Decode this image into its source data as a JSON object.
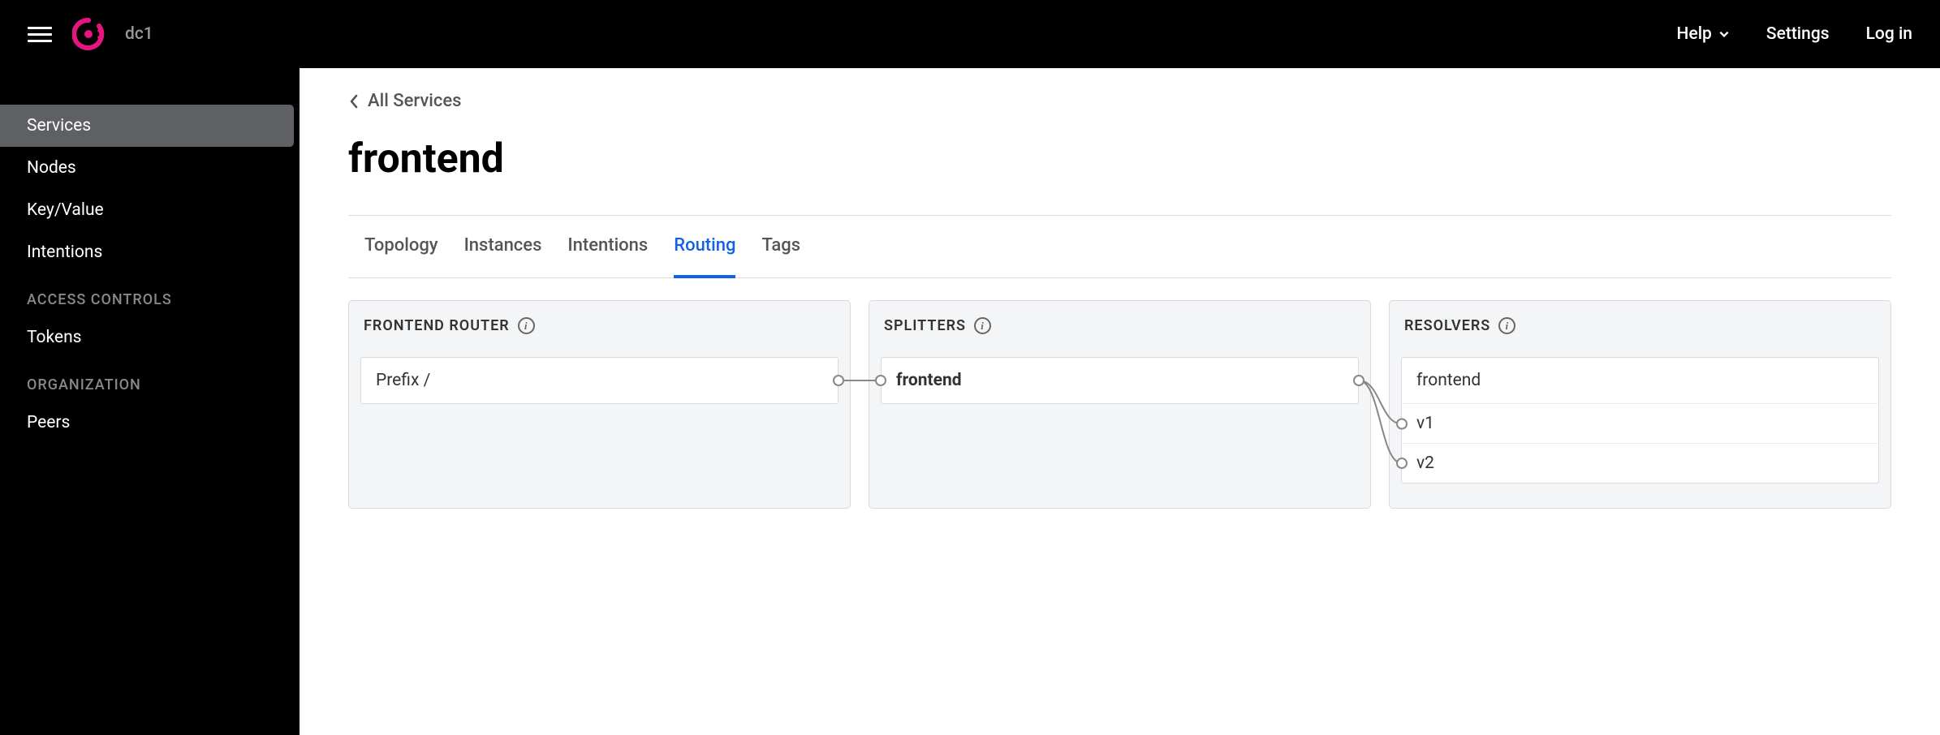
{
  "header": {
    "datacenter": "dc1",
    "help": "Help",
    "settings": "Settings",
    "login": "Log in"
  },
  "sidebar": {
    "items": [
      {
        "label": "Services",
        "active": true
      },
      {
        "label": "Nodes",
        "active": false
      },
      {
        "label": "Key/Value",
        "active": false
      },
      {
        "label": "Intentions",
        "active": false
      }
    ],
    "access_heading": "ACCESS CONTROLS",
    "access_items": [
      {
        "label": "Tokens"
      }
    ],
    "org_heading": "ORGANIZATION",
    "org_items": [
      {
        "label": "Peers"
      }
    ]
  },
  "breadcrumb": {
    "back": "All Services"
  },
  "page": {
    "title": "frontend"
  },
  "tabs": [
    {
      "label": "Topology",
      "active": false
    },
    {
      "label": "Instances",
      "active": false
    },
    {
      "label": "Intentions",
      "active": false
    },
    {
      "label": "Routing",
      "active": true
    },
    {
      "label": "Tags",
      "active": false
    }
  ],
  "router": {
    "title": "FRONTEND ROUTER",
    "item": "Prefix /"
  },
  "splitters": {
    "title": "SPLITTERS",
    "item": "frontend"
  },
  "resolvers": {
    "title": "RESOLVERS",
    "head": "frontend",
    "rows": [
      "v1",
      "v2"
    ]
  }
}
